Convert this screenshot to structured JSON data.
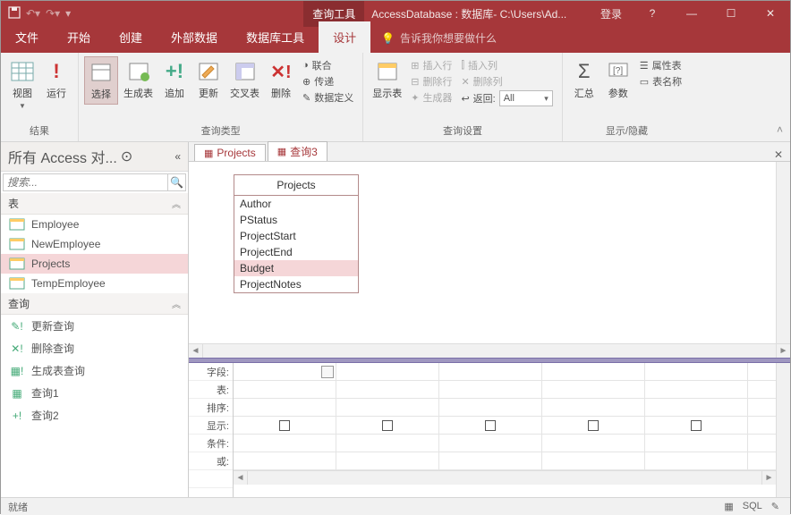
{
  "titlebar": {
    "tools_tab": "查询工具",
    "db_title": "AccessDatabase : 数据库- C:\\Users\\Ad...",
    "login": "登录"
  },
  "menus": {
    "file": "文件",
    "home": "开始",
    "create": "创建",
    "external": "外部数据",
    "dbtools": "数据库工具",
    "design": "设计",
    "tellme": "告诉我你想要做什么"
  },
  "ribbon": {
    "results": {
      "view": "视图",
      "run": "运行",
      "label": "结果"
    },
    "qtype": {
      "select": "选择",
      "maketable": "生成表",
      "append": "追加",
      "update": "更新",
      "crosstab": "交叉表",
      "delete": "删除",
      "union": "联合",
      "passthrough": "传递",
      "datadef": "数据定义",
      "label": "查询类型"
    },
    "qsetup": {
      "showtable": "显示表",
      "insertrow": "插入行",
      "deleterow": "删除行",
      "builder": "生成器",
      "insertcol": "插入列",
      "deletecol": "删除列",
      "return": "返回:",
      "return_val": "All",
      "label": "查询设置"
    },
    "showhide": {
      "totals": "汇总",
      "params": "参数",
      "propsheet": "属性表",
      "tablenames": "表名称",
      "label": "显示/隐藏"
    }
  },
  "nav": {
    "header": "所有 Access 对...",
    "search": "搜索...",
    "section_tables": "表",
    "tables": [
      "Employee",
      "NewEmployee",
      "Projects",
      "TempEmployee"
    ],
    "section_queries": "查询",
    "queries": [
      "更新查询",
      "删除查询",
      "生成表查询",
      "查询1",
      "查询2"
    ]
  },
  "doctabs": {
    "tab1": "Projects",
    "tab2": "查询3"
  },
  "fieldlist": {
    "title": "Projects",
    "fields": [
      "Author",
      "PStatus",
      "ProjectStart",
      "ProjectEnd",
      "Budget",
      "ProjectNotes"
    ],
    "selected": "Budget"
  },
  "gridlabels": {
    "field": "字段:",
    "table": "表:",
    "sort": "排序:",
    "show": "显示:",
    "criteria": "条件:",
    "or": "或:"
  },
  "status": {
    "ready": "就绪",
    "sql": "SQL"
  }
}
